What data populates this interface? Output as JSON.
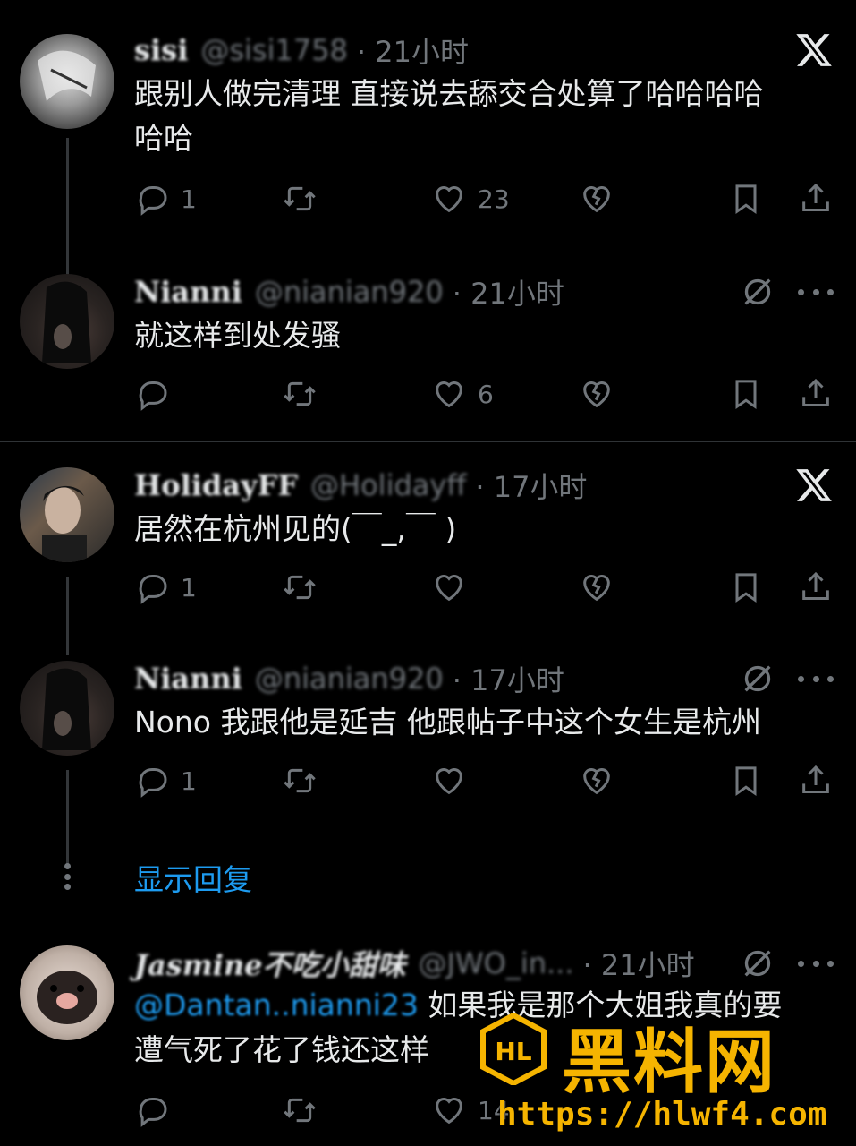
{
  "posts": [
    {
      "name": "sisi",
      "handle": "@sisi1758",
      "time": "· 21小时",
      "text": [
        "跟别人做完清理 直接说去舔交合处算了哈哈哈哈",
        "哈哈"
      ],
      "reply_count": "1",
      "repost_count": "",
      "like_count": "23",
      "top_icon": "x-logo-icon"
    },
    {
      "name": "Nianni",
      "handle": "@nianian920",
      "time": "· 21小时",
      "text": [
        "就这样到处发骚"
      ],
      "reply_count": "",
      "repost_count": "",
      "like_count": "6",
      "top_icon": "grok-icon"
    },
    {
      "name": "HolidayFF",
      "handle": "@Holidayff",
      "time": "· 17小时",
      "text": [
        "居然在杭州见的(￣_,￣ )"
      ],
      "reply_count": "1",
      "repost_count": "",
      "like_count": "",
      "top_icon": "x-logo-icon"
    },
    {
      "name": "Nianni",
      "handle": "@nianian920",
      "time": "· 17小时",
      "text": [
        "Nono 我跟他是延吉 他跟帖子中这个女生是杭州"
      ],
      "reply_count": "1",
      "repost_count": "",
      "like_count": "",
      "top_icon": "grok-icon"
    },
    {
      "name": "Jasmine不吃小甜味",
      "handle": "@JWO_in...",
      "time": "· 21小时",
      "mention": "@Dantan..nianni23",
      "text": [
        "如果我是那个大姐我真的要",
        "遭气死了花了钱还这样"
      ],
      "reply_count": "",
      "repost_count": "",
      "like_count": "14",
      "top_icon": "grok-icon"
    }
  ],
  "show_replies_label": "显示回复",
  "watermark": {
    "title": "黑料网",
    "url": "https://hlwf4.com",
    "logo_text": "HL"
  },
  "colors": {
    "background": "#000000",
    "text": "#e7e9ea",
    "muted": "#71767b",
    "link": "#1d9bf0",
    "watermark": "#f5b400"
  }
}
